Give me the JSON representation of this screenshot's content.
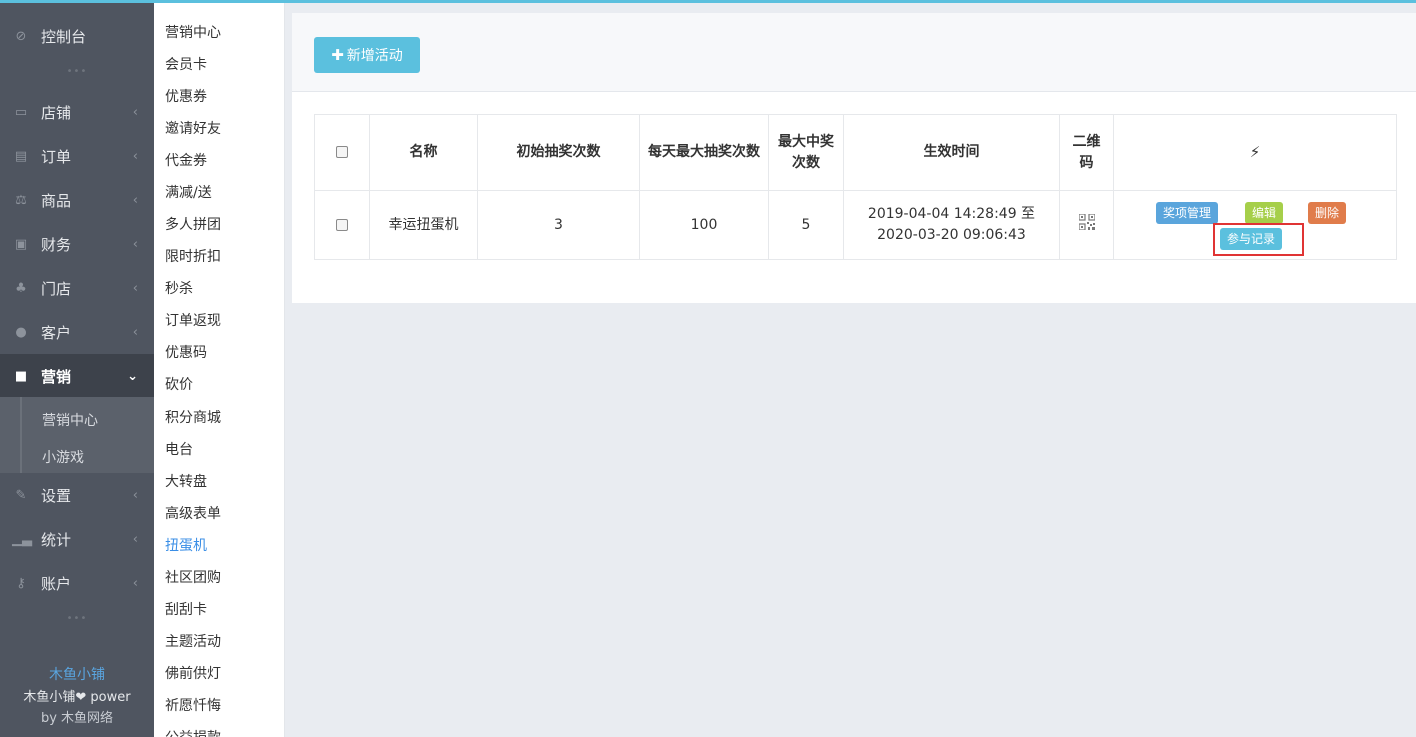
{
  "colors": {
    "accent": "#5bc0de",
    "sidebar_bg": "#4f5560",
    "active_link": "#3a8ee6",
    "highlight_box": "#e03434"
  },
  "sidebar": {
    "items": [
      {
        "label": "控制台",
        "icon": "dashboard-icon"
      },
      {
        "label": "店铺",
        "icon": "shop-icon"
      },
      {
        "label": "订单",
        "icon": "order-icon"
      },
      {
        "label": "商品",
        "icon": "scale-icon"
      },
      {
        "label": "财务",
        "icon": "money-icon"
      },
      {
        "label": "门店",
        "icon": "sitemap-icon"
      },
      {
        "label": "客户",
        "icon": "users-icon"
      },
      {
        "label": "营销",
        "icon": "gift-icon"
      },
      {
        "label": "设置",
        "icon": "wrench-icon"
      },
      {
        "label": "统计",
        "icon": "signal-icon"
      },
      {
        "label": "账户",
        "icon": "key-icon"
      }
    ],
    "sub_items": [
      "营销中心",
      "小游戏"
    ],
    "dots": "•••",
    "footer": {
      "brand": "木鱼小铺",
      "power_line": "木鱼小铺❤ power",
      "by_line": "by 木鱼网络"
    }
  },
  "submenu": {
    "items": [
      "营销中心",
      "会员卡",
      "优惠券",
      "邀请好友",
      "代金券",
      "满减/送",
      "多人拼团",
      "限时折扣",
      "秒杀",
      "订单返现",
      "优惠码",
      "砍价",
      "积分商城",
      "电台",
      "大转盘",
      "高级表单",
      "扭蛋机",
      "社区团购",
      "刮刮卡",
      "主题活动",
      "佛前供灯",
      "祈愿忏悔",
      "公益捐款"
    ],
    "current": "扭蛋机"
  },
  "main": {
    "add_button": "新增活动",
    "table": {
      "headers": {
        "name": "名称",
        "initial_draws": "初始抽奖次数",
        "daily_max_draws": "每天最大抽奖次数",
        "max_wins": "最大中奖次数",
        "effective_time": "生效时间",
        "qrcode": "二维码",
        "actions": "⚡"
      },
      "rows": [
        {
          "name": "幸运扭蛋机",
          "initial_draws": "3",
          "daily_max_draws": "100",
          "max_wins": "5",
          "time_start": "2019-04-04 14:28:49 至",
          "time_end": "2020-03-20 09:06:43",
          "actions": {
            "prizes": "奖项管理",
            "edit": "编辑",
            "delete": "删除",
            "records": "参与记录"
          }
        }
      ]
    }
  }
}
